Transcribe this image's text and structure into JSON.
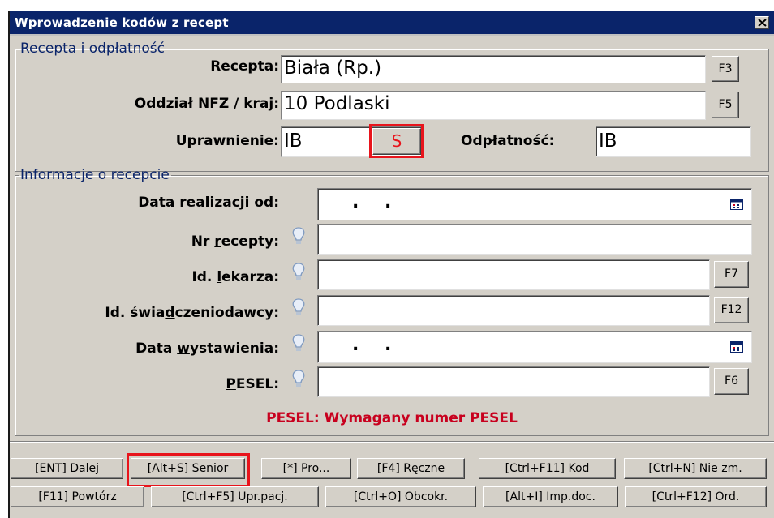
{
  "window": {
    "title": "Wprowadzenie kodów z recept"
  },
  "recepta_section": {
    "legend": "Recepta i odpłatność",
    "recepta_label": "Recepta:",
    "recepta_value": "Biała (Rp.)",
    "recepta_key": "F3",
    "oddzial_label": "Oddział NFZ / kraj:",
    "oddzial_value": "10 Podlaski",
    "oddzial_key": "F5",
    "uprawnienie_label": "Uprawnienie:",
    "uprawnienie_value": "IB",
    "senior_value": "S",
    "odplatnosc_label": "Odpłatność:",
    "odplatnosc_value": "IB"
  },
  "info_section": {
    "legend": "Informacje o recepcie",
    "data_realizacji_pre": "Data realizacji ",
    "data_realizacji_u": "o",
    "data_realizacji_post": "d:",
    "data_realizacji_value": ". .",
    "nr_recepty_pre": "Nr ",
    "nr_recepty_u": "r",
    "nr_recepty_post": "ecepty:",
    "nr_recepty_value": "",
    "id_lekarza_pre": "Id. ",
    "id_lekarza_u": "l",
    "id_lekarza_post": "ekarza:",
    "id_lekarza_value": "",
    "id_lekarza_key": "F7",
    "id_swiad_pre": "Id. świa",
    "id_swiad_u": "d",
    "id_swiad_post": "czeniodawcy:",
    "id_swiad_value": "",
    "id_swiad_key": "F12",
    "data_wyst_pre": "Data ",
    "data_wyst_u": "w",
    "data_wyst_post": "ystawienia:",
    "data_wyst_value": ". .",
    "pesel_pre": "",
    "pesel_u": "P",
    "pesel_post": "ESEL:",
    "pesel_value": "",
    "pesel_key": "F6"
  },
  "error_message": "PESEL: Wymagany numer PESEL",
  "buttons_row1": [
    "[ENT] Dalej",
    "[Alt+S] Senior",
    "[*] Pro...",
    "[F4] Ręczne",
    "[Ctrl+F11] Kod",
    "[Ctrl+N] Nie zm."
  ],
  "buttons_row2": [
    "[F11] Powtórz",
    "[Ctrl+F5] Upr.pacj.",
    "[Ctrl+O] Obcokr.",
    "[Alt+I] Imp.doc.",
    "[Ctrl+F12] Ord."
  ],
  "icons": {
    "close": "close-icon",
    "hint": "lightbulb-icon",
    "calendar": "calendar-icon"
  },
  "colors": {
    "titlebar": "#0a246a",
    "legend": "#0a246a",
    "error": "#c8001e",
    "highlight": "#e8141c"
  }
}
